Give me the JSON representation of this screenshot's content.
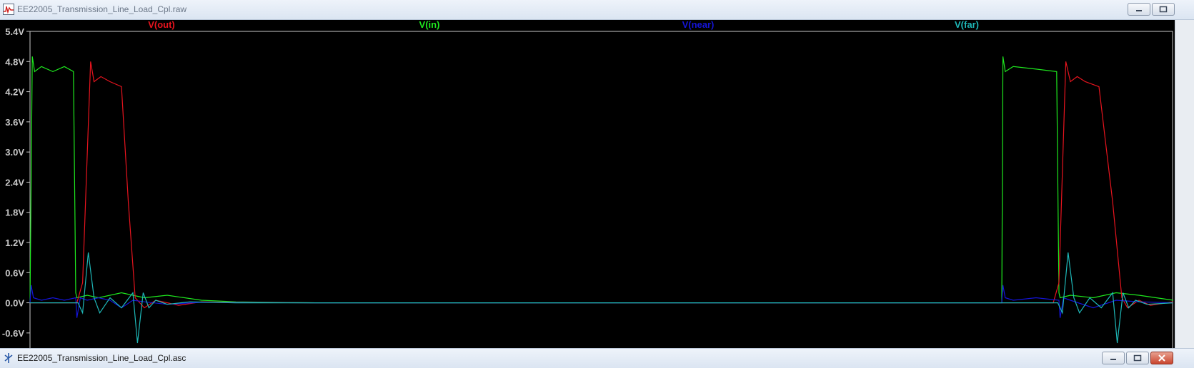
{
  "top_window": {
    "title": "EE22005_Transmission_Line_Load_Cpl.raw"
  },
  "bottom_window": {
    "title": "EE22005_Transmission_Line_Load_Cpl.asc"
  },
  "colors": {
    "v_out": "#e8141e",
    "v_in": "#1ee81e",
    "v_near": "#1414d8",
    "v_far": "#1eb8b8",
    "axis": "#c8c8c8"
  },
  "chart_data": {
    "type": "line",
    "title": "",
    "xlabel": "",
    "ylabel": "",
    "ylim": [
      -0.9,
      5.4
    ],
    "yticks": [
      "5.4V",
      "4.8V",
      "4.2V",
      "3.6V",
      "3.0V",
      "2.4V",
      "1.8V",
      "1.2V",
      "0.6V",
      "0.0V",
      "-0.6V"
    ],
    "ytick_values": [
      5.4,
      4.8,
      4.2,
      3.6,
      3.0,
      2.4,
      1.8,
      1.2,
      0.6,
      0.0,
      -0.6
    ],
    "legend": [
      "V(out)",
      "V(in)",
      "V(near)",
      "V(far)"
    ],
    "xlim": [
      0,
      100
    ],
    "series": [
      {
        "name": "V(in)",
        "color": "#1ee81e",
        "x": [
          0,
          0.2,
          0.4,
          1,
          2,
          3,
          3.8,
          4,
          4.1,
          5,
          6,
          8,
          10,
          12,
          15,
          18,
          25,
          85,
          85.1,
          85.3,
          86,
          88,
          89.8,
          90,
          90.1,
          91,
          93,
          95,
          97,
          100
        ],
        "y": [
          0,
          4.9,
          4.6,
          4.7,
          4.6,
          4.7,
          4.6,
          0.2,
          0.1,
          0.15,
          0.1,
          0.2,
          0.1,
          0.15,
          0.05,
          0.02,
          0,
          0,
          4.9,
          4.6,
          4.7,
          4.65,
          4.6,
          0.2,
          0.1,
          0.15,
          0.1,
          0.2,
          0.15,
          0.05
        ]
      },
      {
        "name": "V(out)",
        "color": "#e8141e",
        "x": [
          0,
          4.1,
          4.6,
          5.3,
          5.6,
          6.2,
          7,
          8,
          8.6,
          9.2,
          10,
          11,
          13,
          15,
          18,
          25,
          85,
          89.5,
          90,
          90.6,
          91,
          91.6,
          92.3,
          93.5,
          94.7,
          95.5,
          96,
          97,
          98,
          100
        ],
        "y": [
          0,
          0,
          0.4,
          4.8,
          4.4,
          4.5,
          4.4,
          4.3,
          2.0,
          0.1,
          -0.1,
          0.05,
          -0.05,
          0.02,
          0.01,
          0,
          0,
          0,
          0.4,
          4.8,
          4.4,
          4.5,
          4.4,
          4.3,
          2.0,
          0.1,
          -0.1,
          0.05,
          -0.05,
          0.02
        ]
      },
      {
        "name": "V(near)",
        "color": "#1414d8",
        "x": [
          0,
          0.1,
          0.3,
          1,
          2,
          3,
          4,
          4.1,
          4.4,
          5,
          6,
          7,
          8,
          9,
          10,
          12,
          15,
          25,
          85,
          85.1,
          85.3,
          86,
          88,
          90,
          90.1,
          90.4,
          91,
          93,
          95,
          97,
          100
        ],
        "y": [
          0,
          0.35,
          0.1,
          0.05,
          0.1,
          0.05,
          0.1,
          -0.3,
          0.1,
          0.05,
          0.1,
          0.05,
          -0.1,
          0.05,
          0.02,
          -0.03,
          0.01,
          0,
          0,
          0.35,
          0.1,
          0.05,
          0.1,
          0.05,
          -0.3,
          0.1,
          0.05,
          -0.1,
          0.05,
          0.02,
          0
        ]
      },
      {
        "name": "V(far)",
        "color": "#1eb8b8",
        "x": [
          0,
          4.2,
          4.6,
          5.1,
          5.6,
          6.1,
          7,
          8,
          9,
          9.4,
          9.9,
          10.4,
          11,
          12,
          14,
          18,
          85,
          89.9,
          90.3,
          90.8,
          91.3,
          91.8,
          92.7,
          93.7,
          94.7,
          95.1,
          95.6,
          96.1,
          96.7,
          97.7,
          100
        ],
        "y": [
          0,
          0,
          -0.2,
          1.0,
          0.1,
          -0.2,
          0.1,
          -0.1,
          0.2,
          -0.8,
          0.2,
          -0.1,
          0.05,
          -0.03,
          0.02,
          0,
          0,
          0,
          -0.2,
          1.0,
          0.1,
          -0.2,
          0.1,
          -0.1,
          0.2,
          -0.8,
          0.2,
          -0.1,
          0.05,
          -0.03,
          0
        ]
      }
    ],
    "grid": false,
    "legend_placement": "top"
  }
}
